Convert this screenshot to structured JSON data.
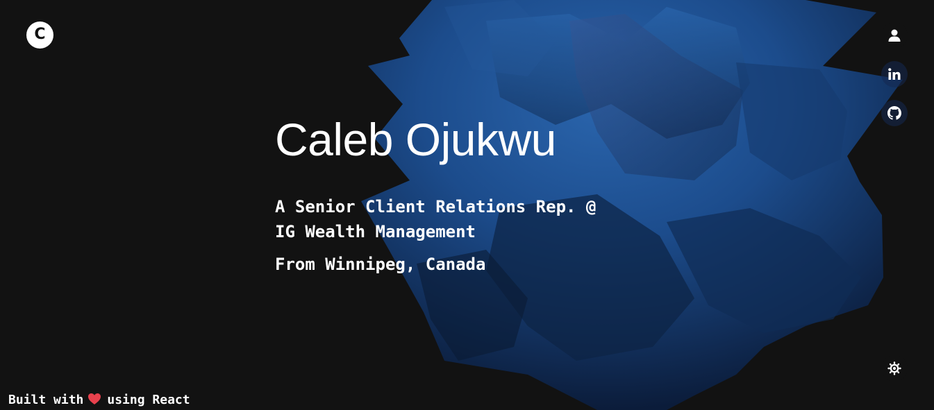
{
  "logo": {
    "letter": "C"
  },
  "hero": {
    "name": "Caleb Ojukwu",
    "tagline_line1": "A Senior Client Relations Rep. @",
    "tagline_line2": "IG Wealth Management",
    "location": "From Winnipeg, Canada"
  },
  "social": [
    {
      "icon": "user-icon"
    },
    {
      "icon": "linkedin-icon"
    },
    {
      "icon": "github-icon"
    }
  ],
  "theme_toggle": {
    "icon": "sun-icon"
  },
  "footer": {
    "prefix": "Built with",
    "icon": "heart-icon",
    "suffix": "using React"
  },
  "colors": {
    "background": "#121212",
    "text": "#ffffff",
    "accent_blue": "#1f5aa0",
    "heart": "#e8414d"
  }
}
